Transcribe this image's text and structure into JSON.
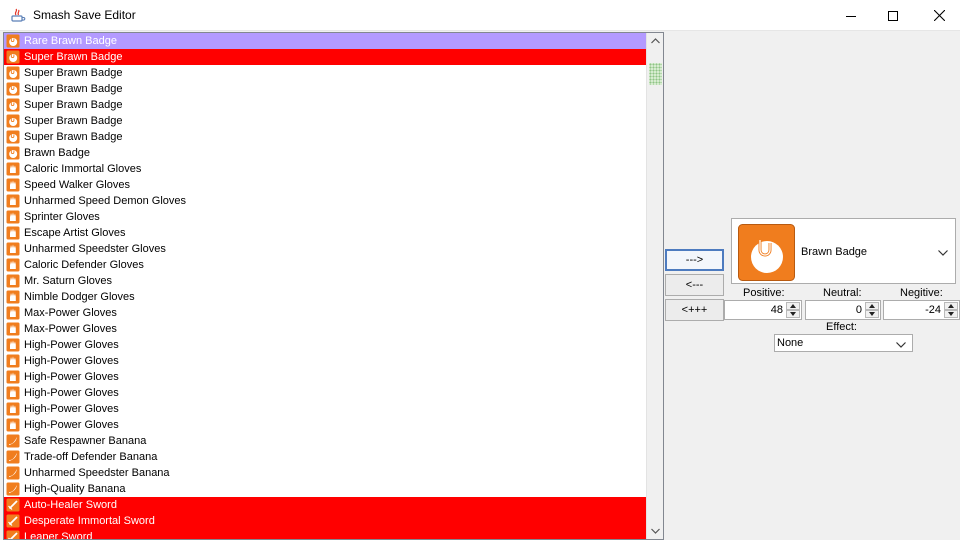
{
  "window": {
    "title": "Smash Save Editor"
  },
  "list": {
    "items": [
      {
        "label": "Rare Brawn Badge",
        "icon": "badge-icon",
        "state": "selected"
      },
      {
        "label": "Super Brawn Badge",
        "icon": "badge-icon",
        "state": "red"
      },
      {
        "label": "Super Brawn Badge",
        "icon": "badge-icon",
        "state": "normal"
      },
      {
        "label": "Super Brawn Badge",
        "icon": "badge-icon",
        "state": "normal"
      },
      {
        "label": "Super Brawn Badge",
        "icon": "badge-icon",
        "state": "normal"
      },
      {
        "label": "Super Brawn Badge",
        "icon": "badge-icon",
        "state": "normal"
      },
      {
        "label": "Super Brawn Badge",
        "icon": "badge-icon",
        "state": "normal"
      },
      {
        "label": "Brawn Badge",
        "icon": "badge-icon",
        "state": "normal"
      },
      {
        "label": "Caloric Immortal Gloves",
        "icon": "gloves-icon",
        "state": "normal"
      },
      {
        "label": "Speed Walker Gloves",
        "icon": "gloves-icon",
        "state": "normal"
      },
      {
        "label": "Unharmed Speed Demon Gloves",
        "icon": "gloves-icon",
        "state": "normal"
      },
      {
        "label": "Sprinter Gloves",
        "icon": "gloves-icon",
        "state": "normal"
      },
      {
        "label": "Escape Artist Gloves",
        "icon": "gloves-icon",
        "state": "normal"
      },
      {
        "label": "Unharmed Speedster Gloves",
        "icon": "gloves-icon",
        "state": "normal"
      },
      {
        "label": "Caloric Defender Gloves",
        "icon": "gloves-icon",
        "state": "normal"
      },
      {
        "label": "Mr. Saturn Gloves",
        "icon": "gloves-icon",
        "state": "normal"
      },
      {
        "label": "Nimble Dodger Gloves",
        "icon": "gloves-icon",
        "state": "normal"
      },
      {
        "label": "Max-Power Gloves",
        "icon": "gloves-icon",
        "state": "normal"
      },
      {
        "label": "Max-Power Gloves",
        "icon": "gloves-icon",
        "state": "normal"
      },
      {
        "label": "High-Power Gloves",
        "icon": "gloves-icon",
        "state": "normal"
      },
      {
        "label": "High-Power Gloves",
        "icon": "gloves-icon",
        "state": "normal"
      },
      {
        "label": "High-Power Gloves",
        "icon": "gloves-icon",
        "state": "normal"
      },
      {
        "label": "High-Power Gloves",
        "icon": "gloves-icon",
        "state": "normal"
      },
      {
        "label": "High-Power Gloves",
        "icon": "gloves-icon",
        "state": "normal"
      },
      {
        "label": "High-Power Gloves",
        "icon": "gloves-icon",
        "state": "normal"
      },
      {
        "label": "Safe Respawner Banana",
        "icon": "banana-icon",
        "state": "normal"
      },
      {
        "label": "Trade-off Defender Banana",
        "icon": "banana-icon",
        "state": "normal"
      },
      {
        "label": "Unharmed Speedster Banana",
        "icon": "banana-icon",
        "state": "normal"
      },
      {
        "label": "High-Quality Banana",
        "icon": "banana-icon",
        "state": "normal"
      },
      {
        "label": "Auto-Healer Sword",
        "icon": "sword-icon",
        "state": "red"
      },
      {
        "label": "Desperate Immortal Sword",
        "icon": "sword-icon",
        "state": "red"
      },
      {
        "label": "Leaper Sword",
        "icon": "sword-icon",
        "state": "red"
      }
    ]
  },
  "buttons": {
    "move_right": "--->",
    "move_left": "<---",
    "add": "<+++"
  },
  "editor": {
    "item_name": "Brawn Badge",
    "positive_label": "Positive:",
    "neutral_label": "Neutral:",
    "negative_label": "Negitive:",
    "positive_value": "48",
    "neutral_value": "0",
    "negative_value": "-24",
    "effect_label": "Effect:",
    "effect_value": "None"
  },
  "colors": {
    "selected_row": "#b39aff",
    "red_row": "#ff0000",
    "item_icon_orange": "#f07d1e",
    "focus_border": "#4d7bbf"
  }
}
